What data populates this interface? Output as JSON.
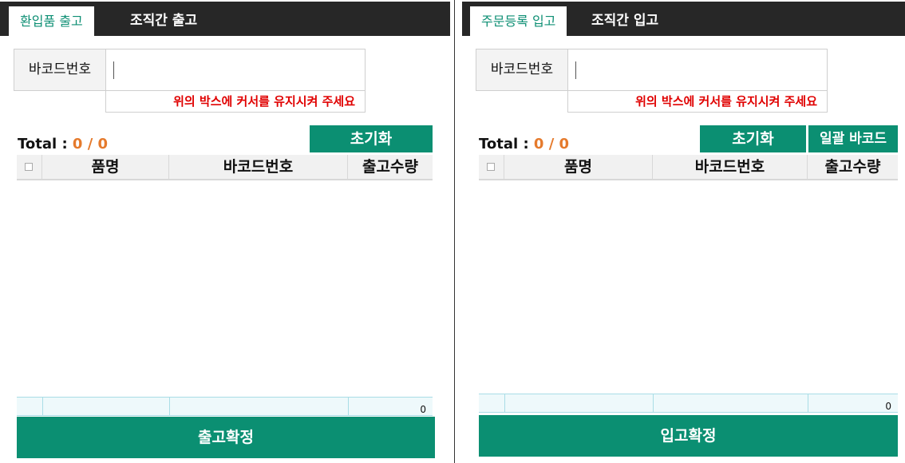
{
  "left": {
    "tabs": {
      "active": "환입품 출고",
      "inactive": "조직간 출고"
    },
    "barcode": {
      "label": "바코드번호",
      "value": "",
      "placeholder": ""
    },
    "hint": "위의 박스에 커서를 유지시켜 주세요",
    "total": {
      "label": "Total :",
      "value": "0 / 0"
    },
    "buttons": {
      "reset": "초기화"
    },
    "columns": [
      "품명",
      "바코드번호",
      "출고수량"
    ],
    "footer_sum": "0",
    "confirm": "출고확정"
  },
  "right": {
    "tabs": {
      "active": "주문등록 입고",
      "inactive": "조직간 입고"
    },
    "barcode": {
      "label": "바코드번호",
      "value": "",
      "placeholder": ""
    },
    "hint": "위의 박스에 커서를 유지시켜 주세요",
    "total": {
      "label": "Total :",
      "value": "0 / 0"
    },
    "buttons": {
      "reset": "초기화",
      "bulk_barcode": "일괄 바코드"
    },
    "columns": [
      "품명",
      "바코드번호",
      "출고수량"
    ],
    "footer_sum": "0",
    "confirm": "입고확정"
  },
  "colors": {
    "accent": "#0b8f72",
    "total_number": "#e57a2c",
    "hint": "#e00000",
    "tabbar": "#272727"
  }
}
